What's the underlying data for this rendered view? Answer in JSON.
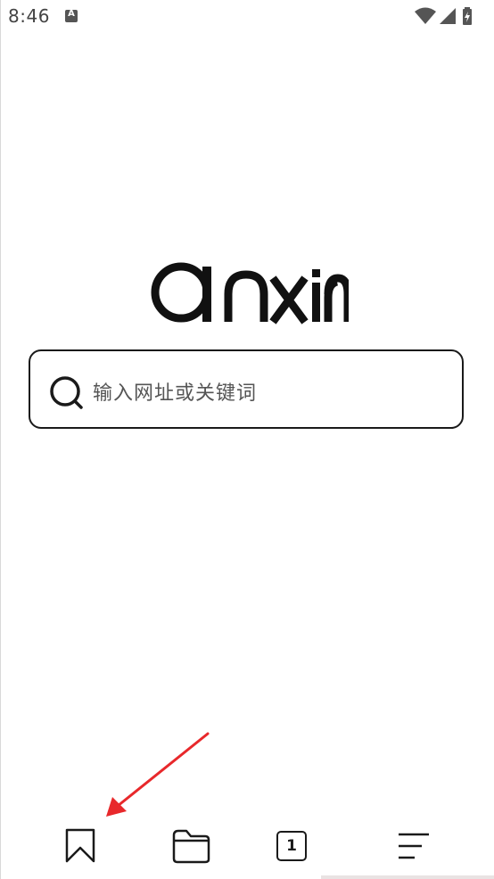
{
  "status_bar": {
    "time": "8:46",
    "notification_icon": "app-notification-icon",
    "notification_letter": "A",
    "icons": [
      "wifi-icon",
      "cellular-signal-icon",
      "battery-charging-icon"
    ]
  },
  "logo": {
    "brand": "anxin",
    "icon": "anxin-logo"
  },
  "search": {
    "icon": "search-icon",
    "placeholder": "输入网址或关键词"
  },
  "annotation": {
    "color": "#e8282b",
    "icon": "red-arrow-annotation"
  },
  "bottom_nav": {
    "items": [
      {
        "name": "bookmarks",
        "icon": "bookmark-icon"
      },
      {
        "name": "files",
        "icon": "folder-icon"
      },
      {
        "name": "tabs",
        "icon": "tab-count-icon",
        "count": "1"
      },
      {
        "name": "menu",
        "icon": "menu-icon"
      }
    ]
  },
  "colors": {
    "background": "#ffffff",
    "foreground": "#1a1a1a",
    "placeholder": "#555555",
    "annotation_red": "#e8282b"
  }
}
